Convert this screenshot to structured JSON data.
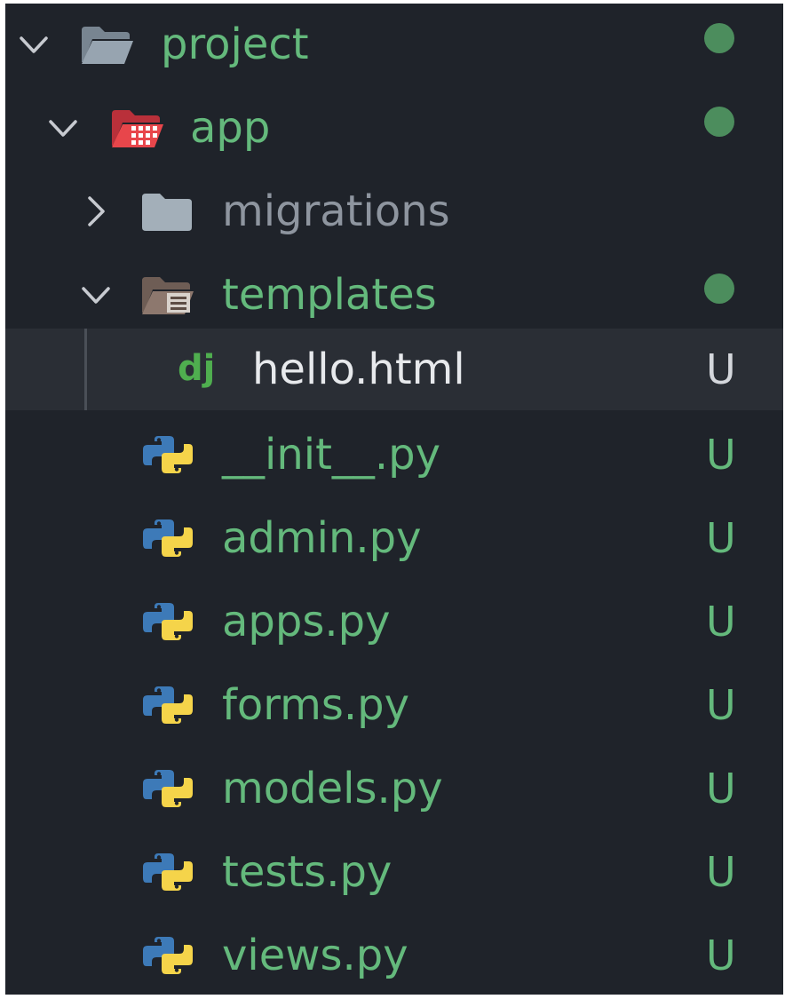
{
  "tree": {
    "project": {
      "label": "project",
      "chevron": "chevron-down-icon",
      "icon": "folder-open-icon"
    },
    "app": {
      "label": "app",
      "chevron": "chevron-down-icon",
      "icon": "folder-app-icon"
    },
    "migrations": {
      "label": "migrations",
      "chevron": "chevron-right-icon",
      "icon": "folder-closed-icon"
    },
    "templates": {
      "label": "templates",
      "chevron": "chevron-down-icon",
      "icon": "folder-templates-icon"
    },
    "hello": {
      "label": "hello.html",
      "icon": "django-icon",
      "status": "U"
    },
    "init": {
      "label": "__init__.py",
      "icon": "python-icon",
      "status": "U"
    },
    "admin": {
      "label": "admin.py",
      "icon": "python-icon",
      "status": "U"
    },
    "apps": {
      "label": "apps.py",
      "icon": "python-icon",
      "status": "U"
    },
    "forms": {
      "label": "forms.py",
      "icon": "python-icon",
      "status": "U"
    },
    "models": {
      "label": "models.py",
      "icon": "python-icon",
      "status": "U"
    },
    "tests": {
      "label": "tests.py",
      "icon": "python-icon",
      "status": "U"
    },
    "views": {
      "label": "views.py",
      "icon": "python-icon",
      "status": "U"
    }
  },
  "colors": {
    "background": "#1f232a",
    "selected_row": "#2a2e35",
    "untracked_text": "#64b97c",
    "modified_dot": "#4c8d5d",
    "ignored_text": "#8e959f",
    "selected_text": "#e7e9ec",
    "python_blue": "#3d7ab8",
    "python_yellow": "#f5d44a",
    "django_green": "#4fae4f",
    "folder_red": "#e8464b"
  }
}
